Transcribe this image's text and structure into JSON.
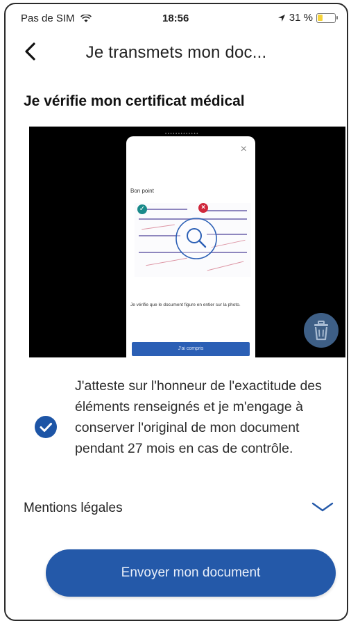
{
  "status_bar": {
    "carrier": "Pas de SIM",
    "time": "18:56",
    "battery": "31 %",
    "battery_level": 0.31
  },
  "nav": {
    "title": "Je transmets mon doc..."
  },
  "section": {
    "title": "Je vérifie mon certificat médical"
  },
  "preview": {
    "caption": "Je vérifie que le document figure en entier sur la photo.",
    "button": "J'ai compris",
    "label": "Bon point"
  },
  "attestation": {
    "checked": true,
    "text": "J'atteste sur l'honneur de l'exactitude des éléments renseignés et je m'engage à conserver l'original de mon document pendant 27 mois en cas de contrôle."
  },
  "mentions": {
    "label": "Mentions légales"
  },
  "actions": {
    "send_label": "Envoyer mon document"
  },
  "colors": {
    "primary": "#2459a9",
    "check": "#1d55a6",
    "trash": "#3e5f86",
    "battery": "#f5d33a"
  }
}
